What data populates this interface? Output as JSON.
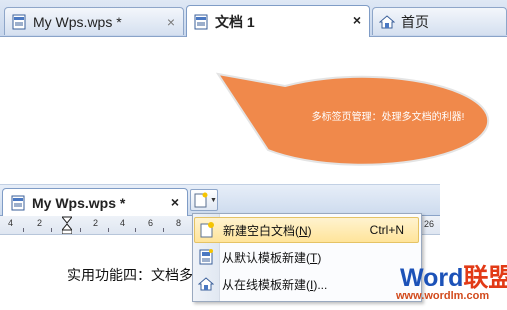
{
  "top_tabs": [
    {
      "label": "My Wps.wps *",
      "close": "×"
    },
    {
      "label": "文档 1",
      "close": "×"
    },
    {
      "label": "首页"
    }
  ],
  "callout": {
    "text": "多标签页管理：处理多文档的利器!",
    "fill": "#f0894b"
  },
  "lower_window": {
    "tab_label": "My Wps.wps *",
    "tab_close": "×",
    "ruler_numbers": [
      "4",
      "2",
      "2",
      "4",
      "6",
      "8"
    ],
    "ruler_right_number": "26",
    "doc_text": "实用功能四：文档多"
  },
  "new_doc_menu": {
    "items": [
      {
        "label": "新建空白文档(",
        "accel": "N",
        "suffix": ")",
        "shortcut": "Ctrl+N",
        "icon": "new-blank-doc-icon"
      },
      {
        "label": "从默认模板新建(",
        "accel": "T",
        "suffix": ")",
        "shortcut": "",
        "icon": "template-doc-icon"
      },
      {
        "label": "从在线模板新建(",
        "accel": "I",
        "suffix": ")...",
        "shortcut": "",
        "icon": "online-template-icon"
      }
    ]
  },
  "watermark": {
    "word": "Word",
    "cn": "联盟",
    "url": "www.wordlm.com"
  }
}
